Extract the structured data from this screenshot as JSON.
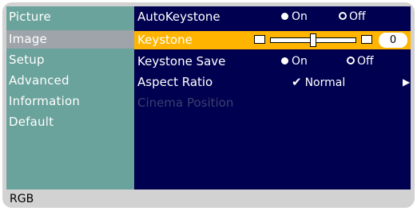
{
  "sidebar": {
    "items": [
      {
        "label": "Picture"
      },
      {
        "label": "Image"
      },
      {
        "label": "Setup"
      },
      {
        "label": "Advanced"
      },
      {
        "label": "Information"
      },
      {
        "label": "Default"
      }
    ],
    "selected": "Image"
  },
  "rows": {
    "auto_keystone": {
      "label": "AutoKeystone",
      "on": "On",
      "off": "Off",
      "value": "On"
    },
    "keystone": {
      "label": "Keystone",
      "value": "0",
      "level": 0.5
    },
    "keystone_save": {
      "label": "Keystone Save",
      "on": "On",
      "off": "Off",
      "value": "On"
    },
    "aspect_ratio": {
      "label": "Aspect Ratio",
      "value": "Normal",
      "check_icon": "checkmark-icon",
      "arrow_icon": "right-arrow-icon"
    },
    "cinema_position": {
      "label": "Cinema Position",
      "enabled": false
    }
  },
  "status": {
    "source": "RGB"
  },
  "colors": {
    "sidebar": "#6aa29c",
    "sidebar_selected": "#9fa4ab",
    "main": "#000050",
    "highlight": "#ffb400",
    "frame": "#d2d2d2"
  }
}
